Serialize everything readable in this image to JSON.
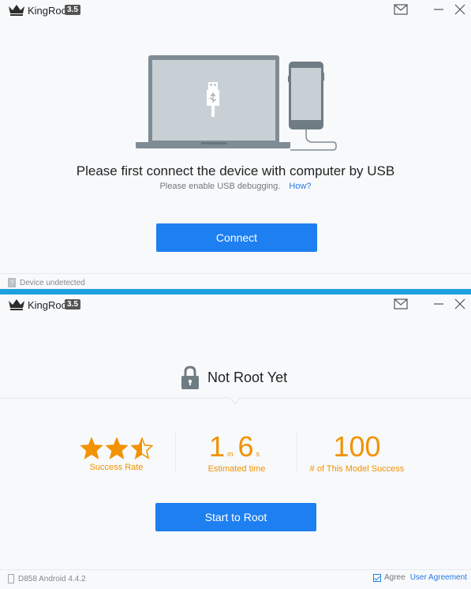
{
  "window1": {
    "app_name": "KingRoot",
    "version": "3.5",
    "headline": "Please first connect the device with computer by USB",
    "subline": "Please enable USB debugging.",
    "how_link": "How?",
    "connect_button": "Connect",
    "status": "Device undetected",
    "status_icon_text": "?"
  },
  "window2": {
    "app_name": "KingRoot",
    "version": "3.5",
    "root_status": "Not Root Yet",
    "success_rate": {
      "stars": 2.5,
      "max": 5,
      "label": "Success Rate"
    },
    "estimated_time": {
      "minutes": "1",
      "minutes_unit": "m",
      "seconds": "6",
      "seconds_unit": "s",
      "label": "Estimated time"
    },
    "model_success": {
      "value": "100",
      "label": "# of This Model Success"
    },
    "start_button": "Start to Root",
    "device_info": "D858 Android 4.4.2",
    "agree_label": "Agree",
    "agreement_link": "User Agreement",
    "agree_checked": true
  },
  "colors": {
    "accent": "#1e7ff0",
    "highlight": "#f29200",
    "divider": "#1ea0e0"
  }
}
